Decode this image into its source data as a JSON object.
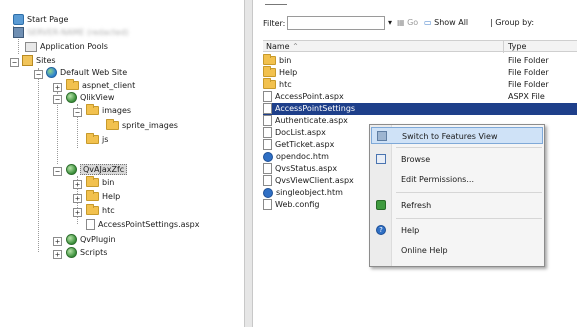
{
  "tree": {
    "start_page": "Start Page",
    "server_name": "SERVER-NAME (redacted)",
    "app_pools": "Application Pools",
    "sites": "Sites",
    "default_site": "Default Web Site",
    "aspnet_client": "aspnet_client",
    "qlikview": "QlikView",
    "images": "images",
    "sprite_images": "sprite_images",
    "js": "js",
    "qvajaxzfc": "QvAJaxZfc",
    "bin": "bin",
    "help": "Help",
    "htc": "htc",
    "access_point_settings": "AccessPointSettings.aspx",
    "qvplugin": "QvPlugin",
    "scripts": "Scripts"
  },
  "toolbar": {
    "filter_label": "Filter:",
    "go": "Go",
    "show_all": "Show All",
    "group_by": "Group by:"
  },
  "list": {
    "col_name": "Name",
    "col_type": "Type",
    "rows": [
      {
        "name": "bin",
        "type": "File Folder"
      },
      {
        "name": "Help",
        "type": "File Folder"
      },
      {
        "name": "htc",
        "type": "File Folder"
      },
      {
        "name": "AccessPoint.aspx",
        "type": "ASPX File"
      },
      {
        "name": "AccessPointSettings",
        "type": ""
      },
      {
        "name": "Authenticate.aspx",
        "type": ""
      },
      {
        "name": "DocList.aspx",
        "type": ""
      },
      {
        "name": "GetTicket.aspx",
        "type": ""
      },
      {
        "name": "opendoc.htm",
        "type": "ment"
      },
      {
        "name": "QvsStatus.aspx",
        "type": ""
      },
      {
        "name": "QvsViewClient.aspx",
        "type": ""
      },
      {
        "name": "singleobject.htm",
        "type": "ment"
      },
      {
        "name": "Web.config",
        "type": "le"
      }
    ]
  },
  "context_menu": {
    "switch_features": "Switch to Features View",
    "browse": "Browse",
    "edit_permissions": "Edit Permissions...",
    "refresh": "Refresh",
    "help": "Help",
    "online_help": "Online Help"
  },
  "colors": {
    "selection": "#1e3f8a",
    "menu_highlight": "#cfe2f7",
    "folder": "#f2c14e"
  },
  "icons": {
    "start_page": "start-page-icon",
    "server": "server-icon",
    "app_pool": "application-pool-icon",
    "sites": "sites-icon",
    "site": "globe-icon",
    "web_app": "web-application-icon",
    "folder": "folder-icon",
    "file": "file-icon",
    "htm": "internet-explorer-icon"
  }
}
